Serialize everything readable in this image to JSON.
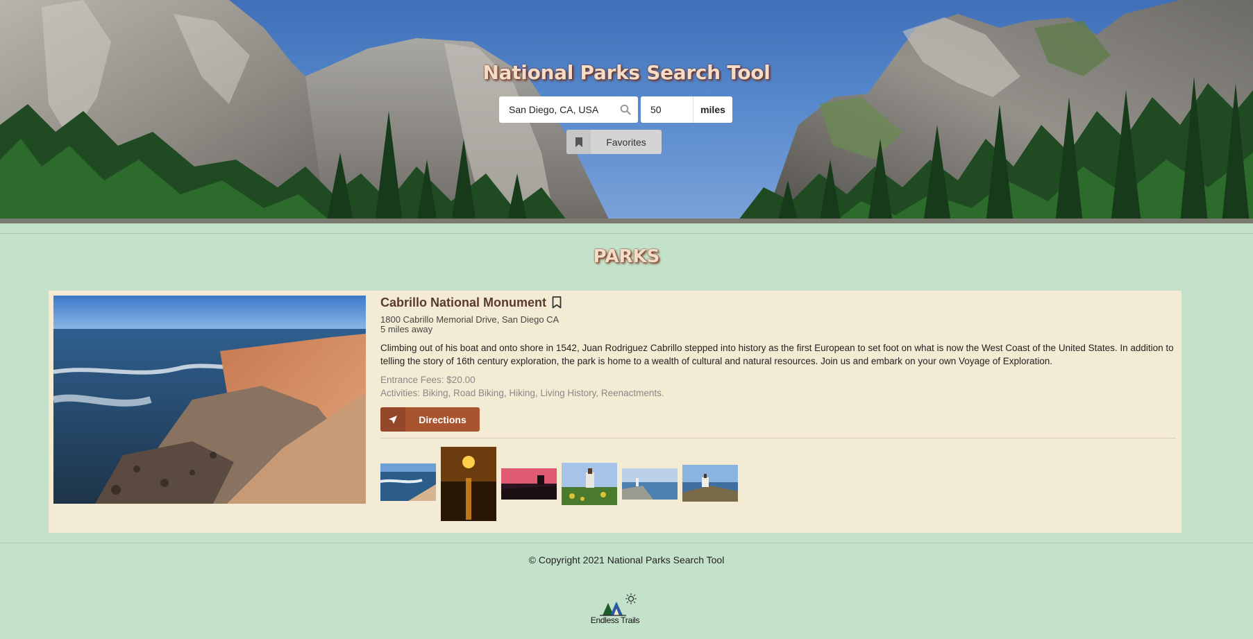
{
  "header": {
    "title": "National Parks Search Tool",
    "location_value": "San Diego, CA, USA",
    "radius_value": "50",
    "radius_unit": "miles",
    "favorites_label": "Favorites"
  },
  "main": {
    "section_title": "PARKS",
    "parks": [
      {
        "name": "Cabrillo National Monument",
        "address": "1800 Cabrillo Memorial Drive, San Diego CA",
        "distance": "5 miles away",
        "description": "Climbing out of his boat and onto shore in 1542, Juan Rodriguez Cabrillo stepped into history as the first European to set foot on what is now the West Coast of the United States. In addition to telling the story of 16th century exploration, the park is home to a wealth of cultural and natural resources. Join us and embark on your own Voyage of Exploration.",
        "fees": "Entrance Fees: $20.00",
        "activities": "Activities: Biking, Road Biking, Hiking, Living History, Reenactments.",
        "directions_label": "Directions"
      }
    ]
  },
  "footer": {
    "copyright": "© Copyright 2021 National Parks Search Tool",
    "logo_text": "Endless Trails"
  },
  "icons": {
    "search": "search-icon",
    "favorites": "bookmark-icon",
    "bookmark_park": "bookmark-outline-icon",
    "directions": "location-arrow-icon"
  },
  "colors": {
    "page_bg": "#c4e2ca",
    "card_bg": "#f3ebd3",
    "directions_button": "#a8542f",
    "title_text": "#f4dcc6",
    "park_name": "#5a3a2e"
  }
}
